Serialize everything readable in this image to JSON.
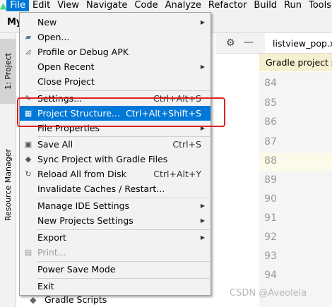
{
  "menubar": {
    "items": [
      {
        "label": "File",
        "active": true
      },
      {
        "label": "Edit"
      },
      {
        "label": "View"
      },
      {
        "label": "Navigate"
      },
      {
        "label": "Code"
      },
      {
        "label": "Analyze"
      },
      {
        "label": "Refactor"
      },
      {
        "label": "Build"
      },
      {
        "label": "Run"
      },
      {
        "label": "Tools"
      }
    ]
  },
  "project_title": "My",
  "side_tabs": {
    "project": "1: Project",
    "resource": "Resource Manager"
  },
  "editor": {
    "file_tab": "listview_pop.xml",
    "notice": "Gradle project sync",
    "line_numbers": [
      "84",
      "85",
      "86",
      "87",
      "88",
      "89",
      "90",
      "91",
      "92",
      "93",
      "94"
    ],
    "current_line": "88"
  },
  "file_menu": {
    "items": [
      {
        "label": "New",
        "icon": "none",
        "submenu": true
      },
      {
        "label": "Open...",
        "icon": "folder-icon"
      },
      {
        "label": "Profile or Debug APK",
        "icon": "profile-icon"
      },
      {
        "label": "Open Recent",
        "submenu": true
      },
      {
        "label": "Close Project"
      },
      {
        "label": "Settings...",
        "icon": "wrench-icon",
        "shortcut": "Ctrl+Alt+S"
      },
      {
        "label": "Project Structure...",
        "icon": "project-structure-icon",
        "shortcut": "Ctrl+Alt+Shift+S",
        "selected": true
      },
      {
        "label": "File Properties",
        "submenu": true
      },
      {
        "label": "Save All",
        "icon": "save-icon",
        "shortcut": "Ctrl+S"
      },
      {
        "label": "Sync Project with Gradle Files",
        "icon": "gradle-sync-icon"
      },
      {
        "label": "Reload All from Disk",
        "icon": "reload-icon",
        "shortcut": "Ctrl+Alt+Y"
      },
      {
        "label": "Invalidate Caches / Restart..."
      },
      {
        "label": "Manage IDE Settings",
        "submenu": true
      },
      {
        "label": "New Projects Settings",
        "submenu": true
      },
      {
        "label": "Export",
        "submenu": true
      },
      {
        "label": "Print...",
        "icon": "print-icon",
        "disabled": true
      },
      {
        "label": "Power Save Mode"
      },
      {
        "label": "Exit"
      }
    ]
  },
  "tree": {
    "gradle_scripts": "Gradle Scripts"
  },
  "watermark": "CSDN @Aveolela",
  "colors": {
    "selection": "#0078d7",
    "highlight_box": "#e02020",
    "android_green": "#3ddc84"
  }
}
